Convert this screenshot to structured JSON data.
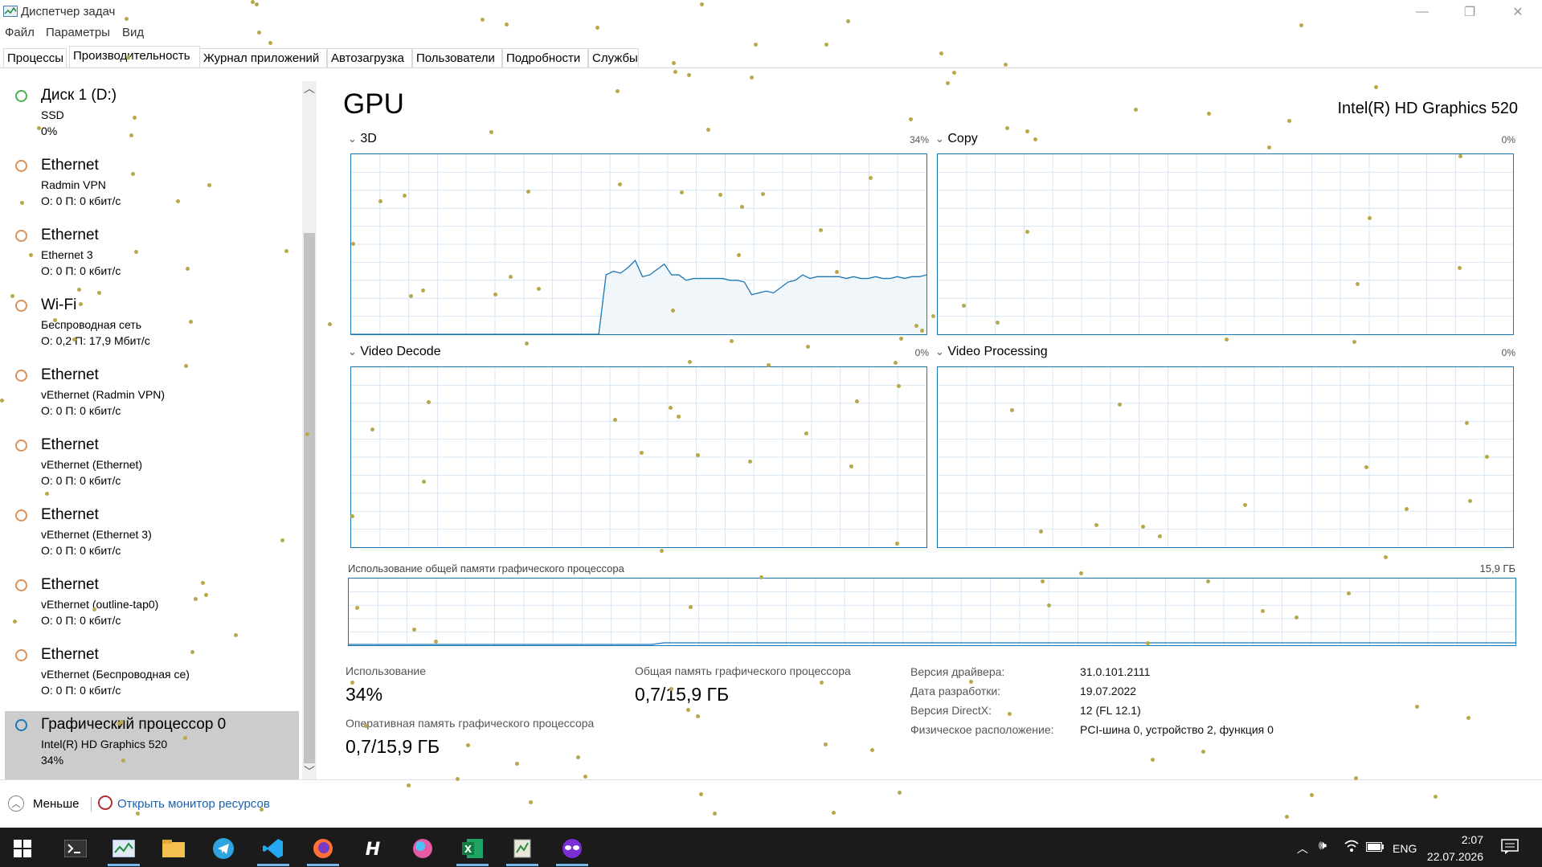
{
  "window": {
    "title": "Диспетчер задач"
  },
  "menu": [
    "Файл",
    "Параметры",
    "Вид"
  ],
  "tabs": [
    "Процессы",
    "Производительность",
    "Журнал приложений",
    "Автозагрузка",
    "Пользователи",
    "Подробности",
    "Службы"
  ],
  "active_tab": "Производительность",
  "sidebar": {
    "items": [
      {
        "name": "Диск 1 (D:)",
        "sub": "SSD",
        "value": "0%",
        "icon_color": "#4caf50"
      },
      {
        "name": "Ethernet",
        "sub": "Radmin VPN",
        "value": "О: 0 П: 0 кбит/с",
        "icon_color": "#d9915a"
      },
      {
        "name": "Ethernet",
        "sub": "Ethernet 3",
        "value": "О: 0 П: 0 кбит/с",
        "icon_color": "#d9915a"
      },
      {
        "name": "Wi-Fi",
        "sub": "Беспроводная сеть",
        "value": "О: 0,2 П: 17,9 Мбит/с",
        "icon_color": "#d9915a"
      },
      {
        "name": "Ethernet",
        "sub": "vEthernet (Radmin VPN)",
        "value": "О: 0 П: 0 кбит/с",
        "icon_color": "#d9915a"
      },
      {
        "name": "Ethernet",
        "sub": "vEthernet (Ethernet)",
        "value": "О: 0 П: 0 кбит/с",
        "icon_color": "#d9915a"
      },
      {
        "name": "Ethernet",
        "sub": "vEthernet (Ethernet 3)",
        "value": "О: 0 П: 0 кбит/с",
        "icon_color": "#d9915a"
      },
      {
        "name": "Ethernet",
        "sub": "vEthernet (outline-tap0)",
        "value": "О: 0 П: 0 кбит/с",
        "icon_color": "#d9915a"
      },
      {
        "name": "Ethernet",
        "sub": "vEthernet (Беспроводная се)",
        "value": "О: 0 П: 0 кбит/с",
        "icon_color": "#d9915a"
      },
      {
        "name": "Графический процессор 0",
        "sub": "Intel(R) HD Graphics 520",
        "value": "34%",
        "icon_color": "#1a77b5"
      }
    ],
    "selected_index": 9
  },
  "main": {
    "title": "GPU",
    "model": "Intel(R) HD Graphics 520",
    "engines": [
      {
        "label": "3D",
        "percent": "34%",
        "chevron": "⌄"
      },
      {
        "label": "Copy",
        "percent": "0%",
        "chevron": "⌄"
      },
      {
        "label": "Video Decode",
        "percent": "0%",
        "chevron": "⌄"
      },
      {
        "label": "Video Processing",
        "percent": "0%",
        "chevron": "⌄"
      }
    ],
    "shared_memory": {
      "label": "Использование общей памяти графического процессора",
      "max": "15,9 ГБ"
    },
    "stats": {
      "usage_label": "Использование",
      "usage_value": "34%",
      "shared_label": "Общая память графического процессора",
      "shared_value": "0,7/15,9 ГБ",
      "ram_label": "Оперативная память графического процессора",
      "ram_value": "0,7/15,9 ГБ"
    },
    "info": [
      {
        "label": "Версия драйвера:",
        "value": "31.0.101.2111"
      },
      {
        "label": "Дата разработки:",
        "value": "19.07.2022"
      },
      {
        "label": "Версия DirectX:",
        "value": "12 (FL 12.1)"
      },
      {
        "label": "Физическое расположение:",
        "value": "PCI-шина 0, устройство 2, функция 0"
      }
    ],
    "graph_3d_values": [
      0,
      0,
      0,
      0,
      0,
      0,
      0,
      0,
      0,
      0,
      0,
      0,
      0,
      0,
      0,
      0,
      0,
      0,
      0,
      0,
      0,
      0,
      0,
      0,
      0,
      0,
      0,
      0,
      0,
      0,
      0,
      0,
      0,
      0,
      0,
      33,
      35,
      34,
      37,
      41,
      32,
      33,
      36,
      39,
      33,
      33,
      30,
      31,
      31,
      31,
      31,
      31,
      30,
      30,
      29,
      22,
      23,
      24,
      23,
      26,
      29,
      30,
      33,
      31,
      32,
      32,
      32,
      32,
      31,
      32,
      31,
      31,
      32,
      31,
      31,
      32,
      31,
      32,
      32,
      33
    ]
  },
  "footer": {
    "less": "Меньше",
    "resmon": "Открыть монитор ресурсов"
  },
  "taskbar": {
    "lang": "ENG",
    "time": "2:07",
    "date": "22.07.2026"
  }
}
